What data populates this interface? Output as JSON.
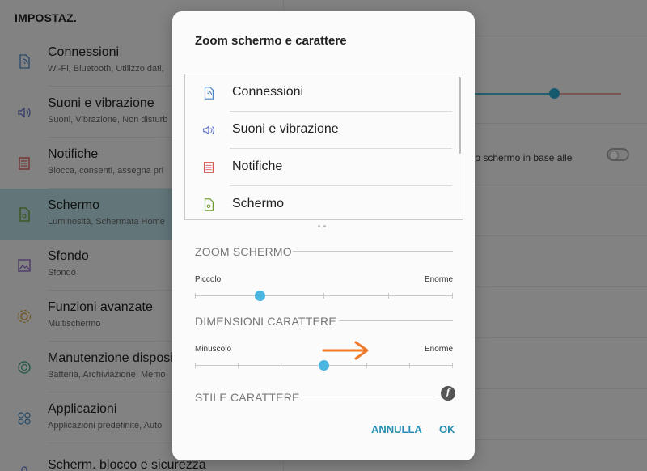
{
  "settings": {
    "title": "IMPOSTAZ.",
    "items": [
      {
        "title": "Connessioni",
        "subtitle": "Wi-Fi, Bluetooth, Utilizzo dati,",
        "icon": "connections-icon"
      },
      {
        "title": "Suoni e vibrazione",
        "subtitle": "Suoni, Vibrazione, Non disturb",
        "icon": "sound-icon"
      },
      {
        "title": "Notifiche",
        "subtitle": "Blocca, consenti, assegna pri",
        "icon": "notifications-icon"
      },
      {
        "title": "Schermo",
        "subtitle": "Luminosità, Schermata Home",
        "icon": "display-icon",
        "selected": true
      },
      {
        "title": "Sfondo",
        "subtitle": "Sfondo",
        "icon": "wallpaper-icon"
      },
      {
        "title": "Funzioni avanzate",
        "subtitle": "Multischermo",
        "icon": "advanced-features-icon"
      },
      {
        "title": "Manutenzione disposi",
        "subtitle": "Batteria, Archiviazione, Memo",
        "icon": "device-maintenance-icon"
      },
      {
        "title": "Applicazioni",
        "subtitle": "Applicazioni predefinite, Auto",
        "icon": "apps-icon"
      },
      {
        "title": "Scherm. blocco e sicurezza",
        "subtitle": "",
        "icon": "lock-icon"
      }
    ]
  },
  "detail": {
    "auto_brightness_text": "llo schermo in base alle",
    "auto_brightness_on": false
  },
  "dialog": {
    "title": "Zoom schermo e carattere",
    "preview_items": [
      {
        "label": "Connessioni",
        "icon": "connections-icon"
      },
      {
        "label": "Suoni e vibrazione",
        "icon": "sound-icon"
      },
      {
        "label": "Notifiche",
        "icon": "notifications-icon"
      },
      {
        "label": "Schermo",
        "icon": "display-icon"
      }
    ],
    "screen_zoom": {
      "heading": "ZOOM SCHERMO",
      "min_label": "Piccolo",
      "max_label": "Enorme",
      "steps": 5,
      "value_index": 1
    },
    "font_size": {
      "heading": "DIMENSIONI CARATTERE",
      "min_label": "Minuscolo",
      "max_label": "Enorme",
      "steps": 7,
      "value_index": 3
    },
    "font_style": {
      "heading": "STILE CARATTERE",
      "icon_glyph": "f"
    },
    "cancel_label": "ANNULLA",
    "ok_label": "OK"
  },
  "colors": {
    "accent": "#4bb6e0",
    "button_text": "#2a8fb0",
    "arrow": "#f07a2b",
    "selected_row": "#b9dfe4"
  }
}
